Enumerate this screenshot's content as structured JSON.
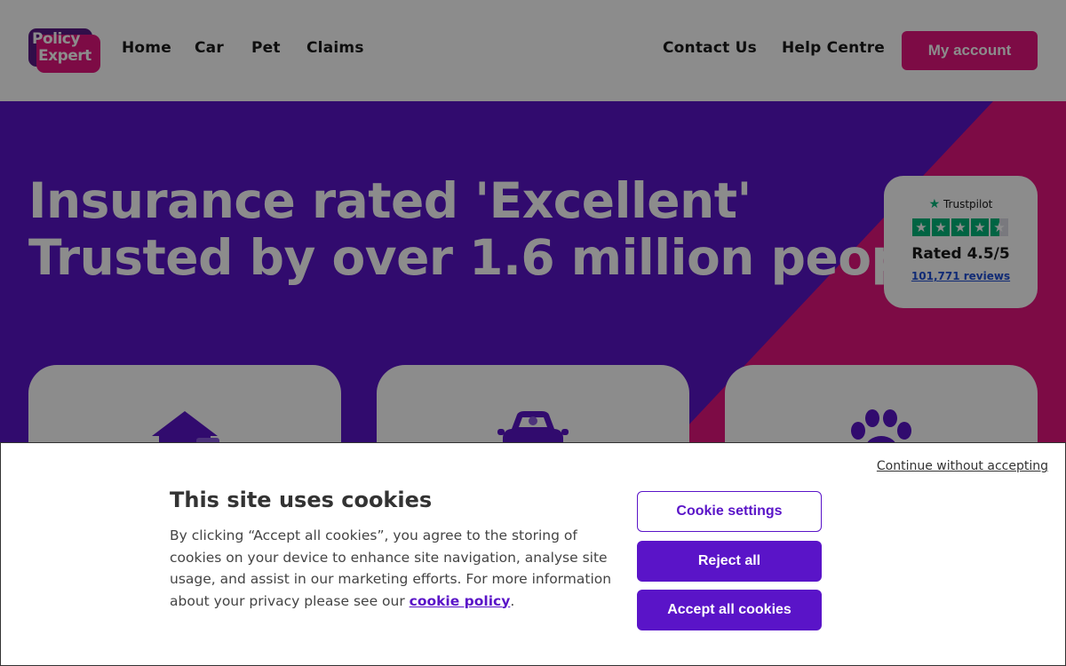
{
  "brand": {
    "logo_line1": "Policy",
    "logo_line2": "Expert",
    "purple": "#5a14c8",
    "pink": "#e3147e"
  },
  "nav": {
    "items": [
      {
        "label": "Home"
      },
      {
        "label": "Car"
      },
      {
        "label": "Pet"
      },
      {
        "label": "Claims"
      }
    ],
    "contact": "Contact Us",
    "help": "Help Centre",
    "account": "My account"
  },
  "hero": {
    "line1": "Insurance rated 'Excellent'",
    "line2": "Trusted by over 1.6 million people",
    "asterisk": "*"
  },
  "trustpilot": {
    "brand": "Trustpilot",
    "rating_label": "Rated 4.5/5",
    "reviews": "101,771 reviews",
    "stars": 4.5,
    "star_color": "#00b67a"
  },
  "products": [
    {
      "icon": "house-icon"
    },
    {
      "icon": "car-icon"
    },
    {
      "icon": "paw-icon"
    }
  ],
  "cookie": {
    "continue": "Continue without accepting",
    "title": "This site uses cookies",
    "body": "By clicking “Accept all cookies”, you agree to the storing of cookies on your device to enhance site navigation, analyse site usage, and assist in our marketing efforts. For more information about your privacy please see our ",
    "link": "cookie policy",
    "period": ".",
    "settings": "Cookie settings",
    "reject": "Reject all",
    "accept": "Accept all cookies"
  }
}
